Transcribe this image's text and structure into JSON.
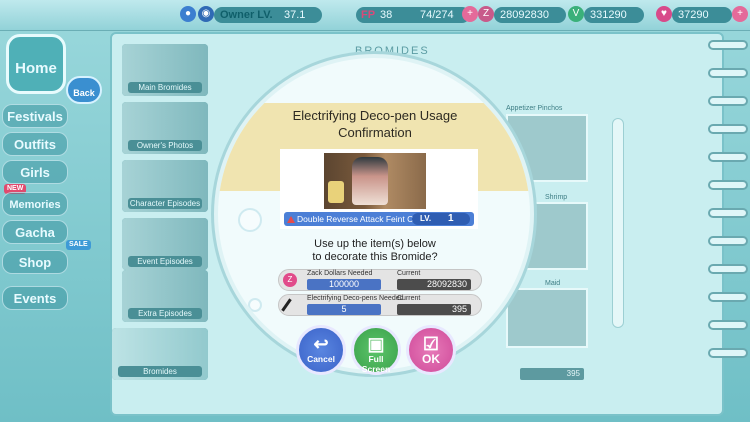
{
  "topbar": {
    "owner_label": "Owner LV.",
    "owner_level": "37.1",
    "fp_label": "FP",
    "fp_value": "38",
    "fp_max": "74/274",
    "zack_dollars": "28092830",
    "vip_points": "331290",
    "v_stones": "37290"
  },
  "nav": {
    "home": "Home",
    "back": "Back",
    "festivals": "Festivals",
    "outfits": "Outfits",
    "girls": "Girls",
    "memories": "Memories",
    "gacha": "Gacha",
    "shop": "Shop",
    "events": "Events",
    "new_tag": "NEW",
    "sale_tag": "SALE"
  },
  "book": {
    "header": "BROMIDES",
    "tabs": [
      "Main Bromides",
      "Owner's Photos",
      "Character Episodes",
      "Event Episodes",
      "Extra Episodes",
      "Bromides"
    ],
    "thumb_captions": [
      "Appetizer Pinchos",
      "Shrimp",
      "Maid"
    ],
    "bottom_count": "395"
  },
  "modal": {
    "title_line1": "Electrifying Deco-pen Usage",
    "title_line2": "Confirmation",
    "bromide_name": "Double Reverse Attack Feint C",
    "lv_label": "LV.",
    "lv_value": "1",
    "question_line1": "Use up the item(s) below",
    "question_line2": "to decorate this Bromide?",
    "rows": [
      {
        "need_label": "Zack Dollars Needed",
        "current_label": "Current",
        "need": "100000",
        "current": "28092830",
        "icon": "zack-dollar-icon"
      },
      {
        "need_label": "Electrifying Deco-pens Needed",
        "current_label": "Current",
        "need": "5",
        "current": "395",
        "icon": "deco-pen-icon"
      }
    ],
    "buttons": {
      "cancel": "Cancel",
      "full_screen": "Full Screen",
      "ok": "OK"
    }
  },
  "colors": {
    "band": "#f0e4b0",
    "need_box": "#4a73c4",
    "cancel": "#3b63c9",
    "full_screen": "#3aa14a",
    "ok": "#d04a9a"
  }
}
